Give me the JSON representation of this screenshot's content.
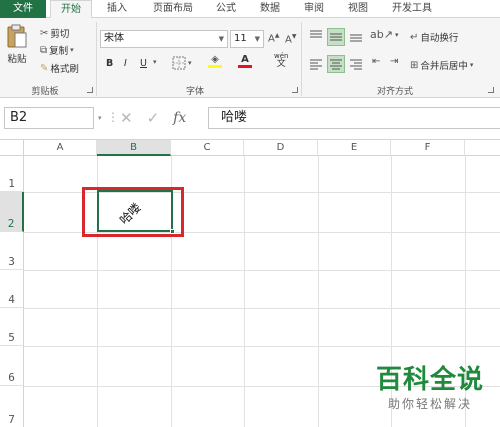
{
  "tabs": [
    "文件",
    "开始",
    "插入",
    "页面布局",
    "公式",
    "数据",
    "审阅",
    "视图",
    "开发工具"
  ],
  "clipboard": {
    "paste": "粘贴",
    "cut": "剪切",
    "copy": "复制",
    "format_painter": "格式刷",
    "group": "剪贴板"
  },
  "font": {
    "name": "宋体",
    "size": "11",
    "bold": "B",
    "italic": "I",
    "underline": "U",
    "group": "字体",
    "wen": "wén",
    "wen_char": "文"
  },
  "alignment": {
    "wrap": "自动换行",
    "merge": "合并后居中",
    "group": "对齐方式"
  },
  "formula_bar": {
    "name_box": "B2",
    "fx": "fx",
    "content": "哈喽"
  },
  "grid": {
    "columns": [
      "A",
      "B",
      "C",
      "D",
      "E",
      "F"
    ],
    "rows": [
      "1",
      "2",
      "3",
      "4",
      "5",
      "6",
      "7"
    ],
    "selected_column": "B",
    "selected_row": "2",
    "cell_b2": "哈喽"
  },
  "watermark": {
    "title": "百科全说",
    "subtitle": "助你轻松解决"
  },
  "colors": {
    "accent": "#217346",
    "highlight": "#d9272e",
    "font_color": "#e81123",
    "fill_color": "#ffff00"
  }
}
